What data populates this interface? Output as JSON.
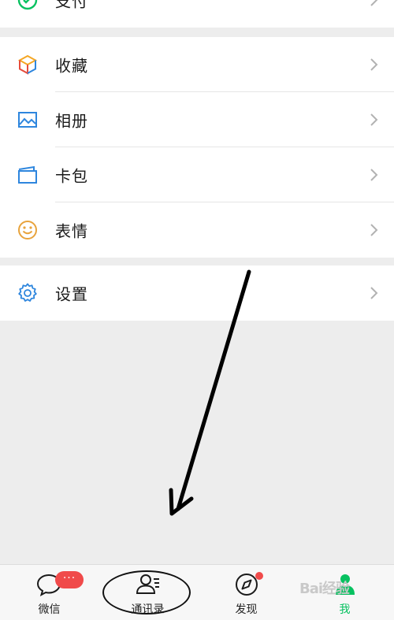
{
  "menu": {
    "top_item": {
      "label": "支付",
      "icon": "wechat-pay-icon"
    },
    "group1": [
      {
        "label": "收藏",
        "icon": "favorites-cube-icon"
      },
      {
        "label": "相册",
        "icon": "album-picture-icon"
      },
      {
        "label": "卡包",
        "icon": "card-wallet-icon"
      },
      {
        "label": "表情",
        "icon": "sticker-smiley-icon"
      }
    ],
    "settings": {
      "label": "设置",
      "icon": "gear-icon"
    }
  },
  "tabbar": {
    "tabs": [
      {
        "label": "微信",
        "icon": "chat-bubble-icon",
        "badge": "···"
      },
      {
        "label": "通讯录",
        "icon": "contacts-icon"
      },
      {
        "label": "发现",
        "icon": "compass-icon"
      },
      {
        "label": "我",
        "icon": "me-person-icon"
      }
    ],
    "watermark": "Bai经验"
  },
  "colors": {
    "accent_green": "#07c160",
    "badge_red": "#f04a4a",
    "background": "#ededed"
  }
}
